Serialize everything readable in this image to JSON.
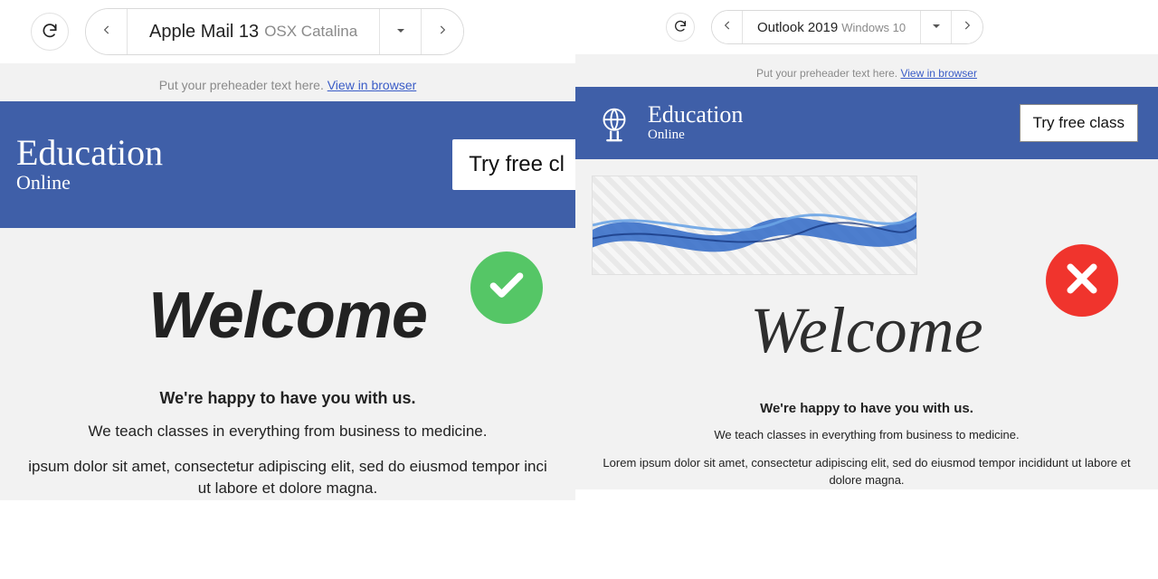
{
  "left": {
    "toolbar": {
      "client_name": "Apple Mail 13",
      "client_os": "OSX Catalina"
    },
    "preheader": {
      "text": "Put your preheader text here. ",
      "link": "View in browser"
    },
    "brand": {
      "line1": "Education",
      "line2": "Online",
      "cta": "Try free cl"
    },
    "content": {
      "welcome": "Welcome",
      "tagline": "We're happy to have you with us.",
      "p1": "We teach classes in everything from business to medicine.",
      "p2": "ipsum dolor sit amet, consectetur adipiscing elit, sed do eiusmod tempor inci ut labore et dolore magna."
    },
    "status": "ok"
  },
  "right": {
    "toolbar": {
      "client_name": "Outlook 2019",
      "client_os": "Windows 10"
    },
    "preheader": {
      "text": "Put your preheader text here. ",
      "link": "View in browser"
    },
    "brand": {
      "line1": "Education",
      "line2": "Online",
      "cta": "Try free class"
    },
    "content": {
      "welcome": "Welcome",
      "tagline": "We're happy to have you with us.",
      "p1": "We teach classes in everything from business to medicine.",
      "p2": "Lorem ipsum dolor sit amet, consectetur adipiscing elit, sed do eiusmod tempor incididunt ut labore et dolore magna."
    },
    "status": "error"
  },
  "colors": {
    "brand_blue": "#3f5fa8",
    "ok_green": "#55c666",
    "err_red": "#f0342d"
  }
}
